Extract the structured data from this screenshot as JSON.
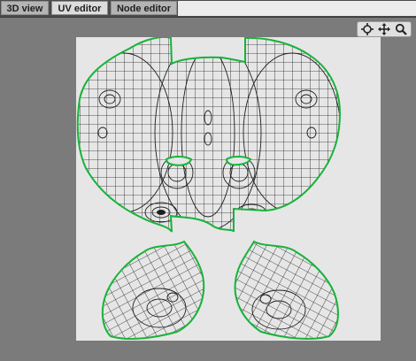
{
  "tabs": [
    {
      "label": "3D view"
    },
    {
      "label": "UV editor"
    },
    {
      "label": "Node editor"
    }
  ],
  "active_tab": "UV editor",
  "toolbar": {
    "icons": [
      "target-icon",
      "move-icon",
      "zoom-icon"
    ]
  },
  "colors": {
    "background": "#7b7b7b",
    "canvas": "#e6e6e6",
    "uv_border": "#17b33a",
    "uv_mesh": "#1e1e1e"
  }
}
